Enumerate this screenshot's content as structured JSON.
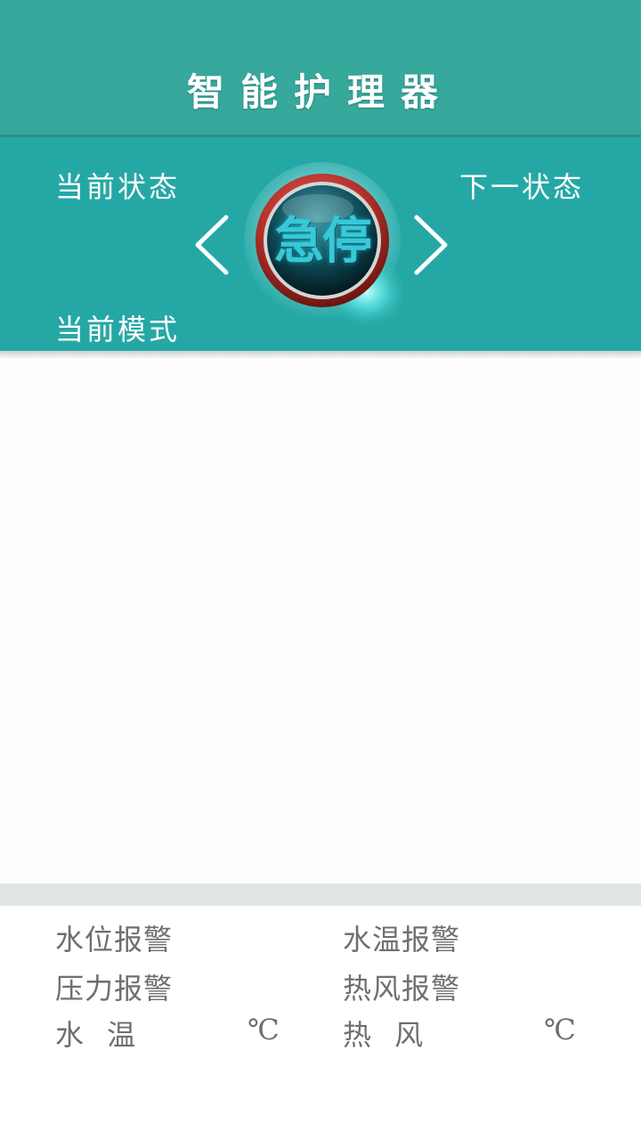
{
  "header": {
    "title": "智能护理器"
  },
  "status": {
    "current_state_label": "当前状态",
    "next_state_label": "下一状态",
    "current_mode_label": "当前模式",
    "estop_label": "急停",
    "prev_icon": "chevron-left-icon",
    "next_icon": "chevron-right-icon"
  },
  "alarms": {
    "water_level": "水位报警",
    "water_temp": "水温报警",
    "pressure": "压力报警",
    "hot_air": "热风报警",
    "water_temp_reading_label": "水 温",
    "water_temp_unit": "℃",
    "hot_air_reading_label": "热 风",
    "hot_air_unit": "℃"
  },
  "colors": {
    "header_bg": "#37a89c",
    "status_bg": "#25a8a5",
    "estop_ring": "#b8332c",
    "alarm_text": "#6f6f6f"
  }
}
